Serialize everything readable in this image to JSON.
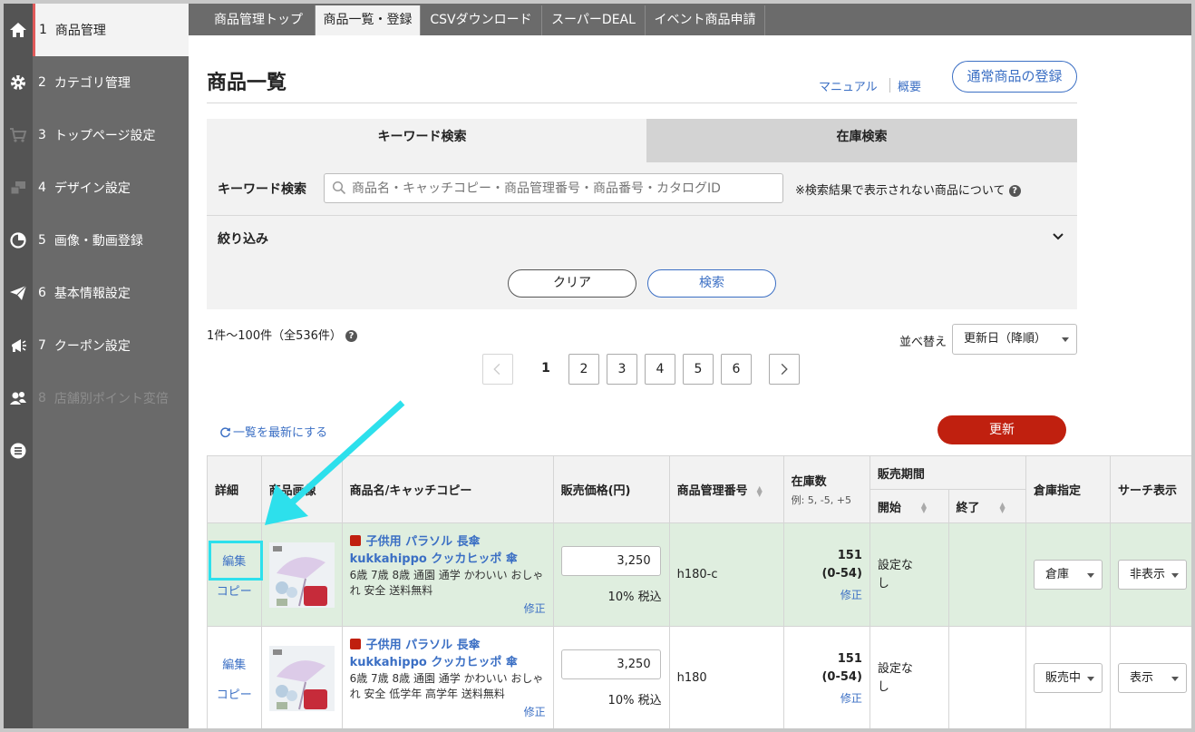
{
  "sidebar": {
    "items": [
      {
        "num": "1",
        "label": "商品管理",
        "icon": "home-icon"
      },
      {
        "num": "2",
        "label": "カテゴリ管理",
        "icon": "gear-icon"
      },
      {
        "num": "3",
        "label": "トップページ設定",
        "icon": "cart-icon"
      },
      {
        "num": "4",
        "label": "デザイン設定",
        "icon": "design-icon"
      },
      {
        "num": "5",
        "label": "画像・動画登録",
        "icon": "pie-icon"
      },
      {
        "num": "6",
        "label": "基本情報設定",
        "icon": "send-icon"
      },
      {
        "num": "7",
        "label": "クーポン設定",
        "icon": "megaphone-icon"
      },
      {
        "num": "8",
        "label": "店舗別ポイント変倍",
        "icon": "users-icon"
      }
    ],
    "bottom_icon": "list-icon"
  },
  "topnav": {
    "tabs": [
      "商品管理トップ",
      "商品一覧・登録",
      "CSVダウンロード",
      "スーパーDEAL",
      "イベント商品申請"
    ],
    "active_index": 1
  },
  "page": {
    "title": "商品一覧",
    "manual_link": "マニュアル",
    "overview_link": "概要",
    "register_button": "通常商品の登録"
  },
  "search": {
    "tab_keyword": "キーワード検索",
    "tab_stock": "在庫検索",
    "keyword_label": "キーワード検索",
    "keyword_placeholder": "商品名・キャッチコピー・商品管理番号・商品番号・カタログID",
    "note": "※検索結果で表示されない商品について",
    "filter_label": "絞り込み",
    "clear_button": "クリア",
    "search_button": "検索"
  },
  "results": {
    "count_text": "1件〜100件（全536件）",
    "sort_label": "並べ替え",
    "sort_value": "更新日（降順）",
    "pages": [
      "1",
      "2",
      "3",
      "4",
      "5",
      "6"
    ],
    "current_page": "1",
    "refresh_link": "一覧を最新にする",
    "update_button": "更新"
  },
  "table": {
    "headers": {
      "detail": "詳細",
      "image": "商品画像",
      "name": "商品名/キャッチコピー",
      "price": "販売価格(円)",
      "manage_no": "商品管理番号",
      "stock": "在庫数",
      "stock_hint": "例: 5, -5, +5",
      "period": "販売期間",
      "period_start": "開始",
      "period_end": "終了",
      "warehouse": "倉庫指定",
      "search_display": "サーチ表示"
    },
    "rows": [
      {
        "edit": "編集",
        "copy": "コピー",
        "name": "子供用 パラソル 長傘 kukkahippo クッカヒッポ 傘 雨...",
        "catch": "6歳 7歳 8歳 通園 通学 かわいい おしゃれ 安全 送料無料",
        "modify": "修正",
        "price": "3,250",
        "tax_note": "10% 税込",
        "manage_no": "h180-c",
        "stock": "151",
        "stock_range": "(0-54)",
        "stock_modify": "修正",
        "period": "設定なし",
        "warehouse": "倉庫",
        "search_display": "非表示"
      },
      {
        "edit": "編集",
        "copy": "コピー",
        "name": "子供用 パラソル 長傘 kukkahippo クッカヒッポ 傘 雨...",
        "catch": "6歳 7歳 8歳 通園 通学 かわいい おしゃれ 安全 低学年 高学年 送料無料",
        "modify": "修正",
        "price": "3,250",
        "tax_note": "10% 税込",
        "manage_no": "h180",
        "stock": "151",
        "stock_range": "(0-54)",
        "stock_modify": "修正",
        "period": "設定なし",
        "warehouse": "販売中",
        "search_display": "表示"
      }
    ]
  },
  "colors": {
    "accent_blue": "#3b6fc4",
    "update_red": "#c0200f",
    "highlight_row": "#dfeedf",
    "annotation_cyan": "#2de0ec"
  }
}
